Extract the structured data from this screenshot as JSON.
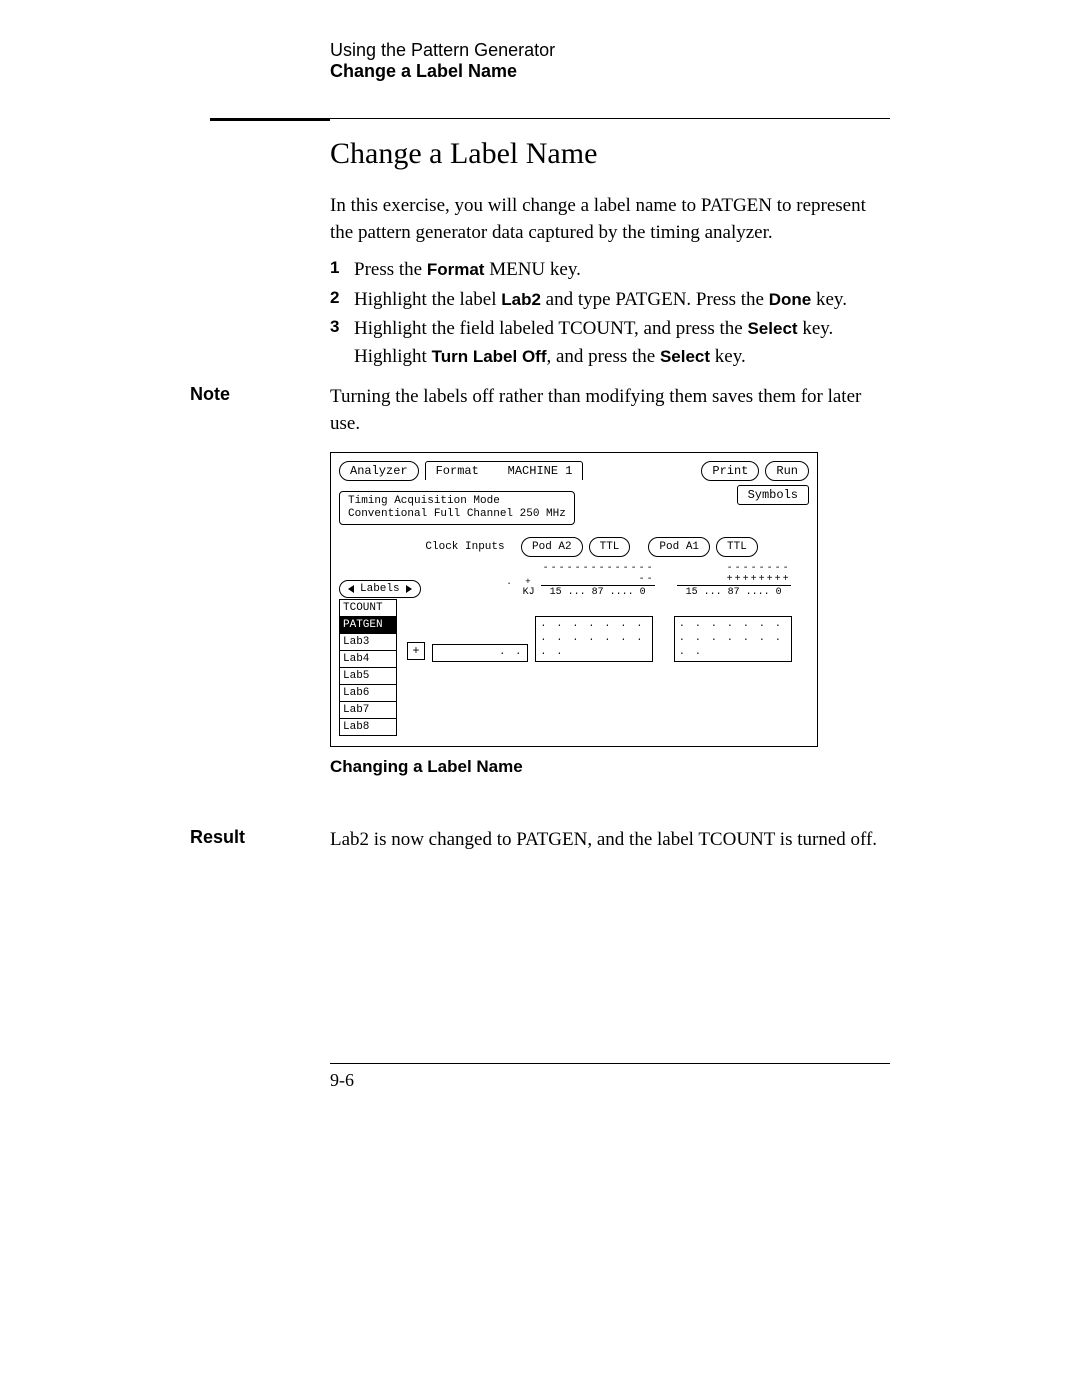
{
  "header": {
    "chapter": "Using the Pattern Generator",
    "section_bold": "Change a Label Name"
  },
  "title": "Change a Label Name",
  "intro": "In this exercise, you will change a label name to PATGEN to represent the pattern generator data captured by the timing analyzer.",
  "steps": {
    "s1": {
      "num": "1",
      "a": "Press the ",
      "b": "Format",
      "c": " MENU key."
    },
    "s2": {
      "num": "2",
      "a": "Highlight the label ",
      "b": "Lab2",
      "c": " and type PATGEN. Press the ",
      "d": "Done",
      "e": " key."
    },
    "s3": {
      "num": "3",
      "a": "Highlight the field labeled TCOUNT, and press the ",
      "b": "Select",
      "c": " key. Highlight ",
      "d": "Turn Label Off",
      "e": ", and press the ",
      "f": "Select",
      "g": " key."
    }
  },
  "note": {
    "label": "Note",
    "text": "Turning the labels off rather than modifying them saves them for later use."
  },
  "screen": {
    "top": {
      "analyzer": "Analyzer",
      "format": "Format",
      "machine": "MACHINE 1",
      "print": "Print",
      "run": "Run",
      "symbols": "Symbols"
    },
    "mode": {
      "line1": "Timing Acquisition Mode",
      "line2": "Conventional  Full Channel  250 MHz"
    },
    "pods": {
      "clock_inputs": "Clock Inputs",
      "podA2": "Pod A2",
      "ttl1": "TTL",
      "podA1": "Pod A1",
      "ttl2": "TTL"
    },
    "labels_btn": "Labels",
    "kj": "KJ",
    "scaleA": "15 ... 87 .... 0",
    "scaleB": "15 ... 87 .... 0",
    "ticksA": "----------------",
    "ticksB": "--------++++++++",
    "label_rows": [
      "TCOUNT",
      "PATGEN",
      "Lab3",
      "Lab4",
      "Lab5",
      "Lab6",
      "Lab7",
      "Lab8"
    ],
    "plus": "+",
    "strip1": ". .",
    "strip2": ". . . . . . . . . . . . . . . .",
    "strip3": ". . . . . . . . . . . . . . . ."
  },
  "caption": "Changing a Label Name",
  "result": {
    "label": "Result",
    "text": "Lab2 is now changed to PATGEN, and the label TCOUNT is turned off."
  },
  "pagenum": "9-6"
}
